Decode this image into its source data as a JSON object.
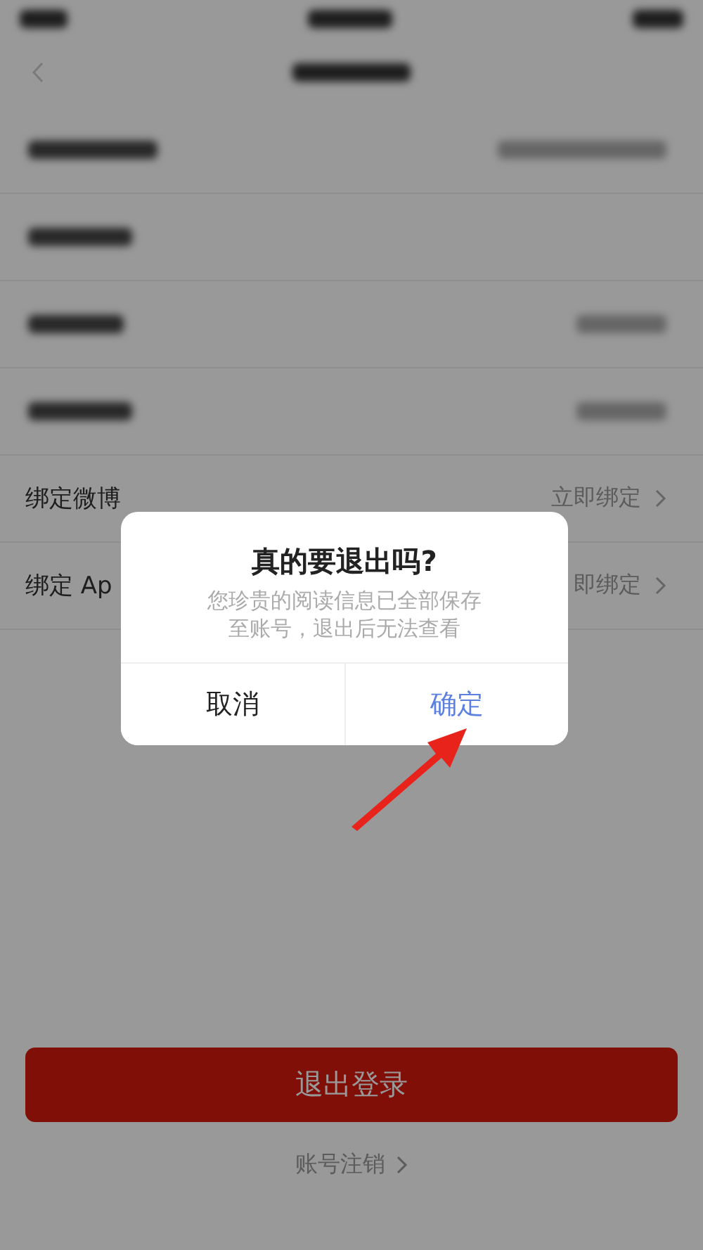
{
  "settings_rows": [
    {
      "label": "绑定微博",
      "action": "立即绑定"
    },
    {
      "label": "绑定 Ap",
      "action": "即绑定"
    }
  ],
  "logout_button": "退出登录",
  "delete_account_link": "账号注销",
  "dialog": {
    "title": "真的要退出吗?",
    "message": "您珍贵的阅读信息已全部保存至账号，退出后无法查看",
    "buttons": [
      {
        "label": "取消",
        "kind": "cancel"
      },
      {
        "label": "确定",
        "kind": "confirm"
      }
    ]
  }
}
